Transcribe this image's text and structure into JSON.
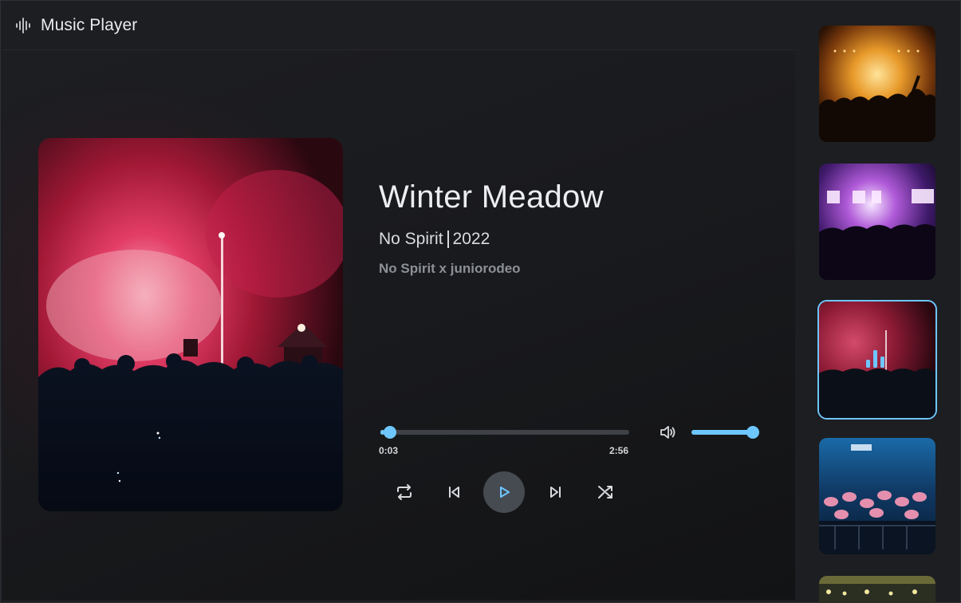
{
  "app": {
    "title": "Music Player",
    "logo_icon": "audio-waveform-icon"
  },
  "now_playing": {
    "title": "Winter Meadow",
    "artist": "No Spirit",
    "year": "2022",
    "credits": "No Spirit x juniorodeo",
    "album_art": "crowd-red-smoke-concert-image"
  },
  "progress": {
    "elapsed": "0:03",
    "total": "2:56",
    "fraction": 0.017
  },
  "volume": {
    "icon": "volume-icon",
    "level": 1.0
  },
  "controls": {
    "repeat_icon": "repeat-icon",
    "previous_icon": "skip-previous-icon",
    "play_icon": "play-icon",
    "next_icon": "skip-next-icon",
    "shuffle_icon": "shuffle-icon"
  },
  "playlist": [
    {
      "thumbnail": "orange-stage-concert-crowd",
      "active": false
    },
    {
      "thumbnail": "purple-lights-concert-crowd",
      "active": false
    },
    {
      "thumbnail": "red-smoke-concert-crowd",
      "active": true,
      "indicator_icon": "equalizer-bars-icon"
    },
    {
      "thumbnail": "blue-festival-crowd-hands",
      "active": false
    },
    {
      "thumbnail": "yellow-lights-stage",
      "active": false
    }
  ],
  "colors": {
    "accent": "#6ec6ff",
    "background": "#1c1e21",
    "play_button": "#464a51",
    "muted_text": "#8d9096"
  }
}
